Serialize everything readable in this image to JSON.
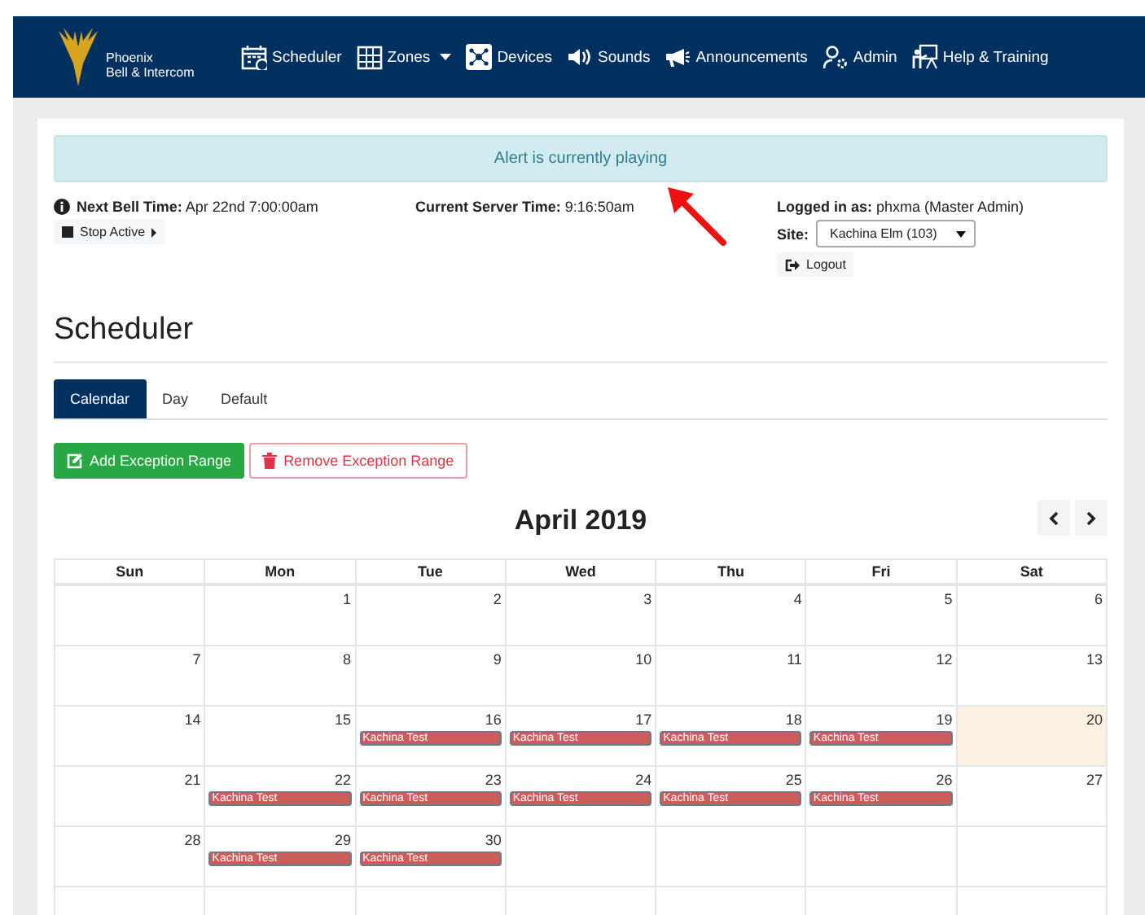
{
  "brand": {
    "line1": "Phoenix",
    "line2": "Bell & Intercom"
  },
  "nav": [
    {
      "label": "Scheduler",
      "dropdown": false
    },
    {
      "label": "Zones",
      "dropdown": true
    },
    {
      "label": "Devices",
      "dropdown": false
    },
    {
      "label": "Sounds",
      "dropdown": false
    },
    {
      "label": "Announcements",
      "dropdown": false
    },
    {
      "label": "Admin",
      "dropdown": false
    },
    {
      "label": "Help & Training",
      "dropdown": false
    }
  ],
  "alert": "Alert is currently playing",
  "info": {
    "next_bell": "**Next Bell Time:** Apr 22nd 7:00:00am",
    "stop_button": "Stop Active",
    "server_time": "**Current Server Time:** 9:16:50am",
    "logged_in": "**Logged in as:** phxma (Master Admin)",
    "site_label": "Site:",
    "site_value": "Kachina Elm (103)",
    "logout_button": "Logout"
  },
  "heading": "Scheduler",
  "tabs": [
    {
      "label": "Calendar",
      "selected": true
    },
    {
      "label": "Day",
      "selected": false
    },
    {
      "label": "Default",
      "selected": false
    }
  ],
  "actions": [
    {
      "label": "Add Exception Range",
      "kind": "add"
    },
    {
      "label": "Remove Exception Range",
      "kind": "remove"
    }
  ],
  "calendar": {
    "title": "April 2019",
    "weekdays": [
      "Sun",
      "Mon",
      "Tue",
      "Wed",
      "Thu",
      "Fri",
      "Sat"
    ],
    "weeks": [
      [
        {
          "empty": true
        },
        {
          "empty": false,
          "day": "1",
          "today": false
        },
        {
          "empty": false,
          "day": "2",
          "today": false
        },
        {
          "empty": false,
          "day": "3",
          "today": false
        },
        {
          "empty": false,
          "day": "4",
          "today": false
        },
        {
          "empty": false,
          "day": "5",
          "today": false
        },
        {
          "empty": false,
          "day": "6",
          "today": false
        }
      ],
      [
        {
          "empty": false,
          "day": "7",
          "today": false
        },
        {
          "empty": false,
          "day": "8",
          "today": false
        },
        {
          "empty": false,
          "day": "9",
          "today": false
        },
        {
          "empty": false,
          "day": "10",
          "today": false
        },
        {
          "empty": false,
          "day": "11",
          "today": false
        },
        {
          "empty": false,
          "day": "12",
          "today": false
        },
        {
          "empty": false,
          "day": "13",
          "today": false
        }
      ],
      [
        {
          "empty": false,
          "day": "14",
          "today": false
        },
        {
          "empty": false,
          "day": "15",
          "today": false
        },
        {
          "empty": false,
          "day": "16",
          "today": false,
          "events": [
            "Kachina Test"
          ]
        },
        {
          "empty": false,
          "day": "17",
          "today": false,
          "events": [
            "Kachina Test"
          ]
        },
        {
          "empty": false,
          "day": "18",
          "today": false,
          "events": [
            "Kachina Test"
          ]
        },
        {
          "empty": false,
          "day": "19",
          "today": false,
          "events": [
            "Kachina Test"
          ]
        },
        {
          "empty": false,
          "day": "20",
          "today": true
        }
      ],
      [
        {
          "empty": false,
          "day": "21",
          "today": false
        },
        {
          "empty": false,
          "day": "22",
          "today": false,
          "events": [
            "Kachina Test"
          ]
        },
        {
          "empty": false,
          "day": "23",
          "today": false,
          "events": [
            "Kachina Test"
          ]
        },
        {
          "empty": false,
          "day": "24",
          "today": false,
          "events": [
            "Kachina Test"
          ]
        },
        {
          "empty": false,
          "day": "25",
          "today": false,
          "events": [
            "Kachina Test"
          ]
        },
        {
          "empty": false,
          "day": "26",
          "today": false,
          "events": [
            "Kachina Test"
          ]
        },
        {
          "empty": false,
          "day": "27",
          "today": false
        }
      ],
      [
        {
          "empty": false,
          "day": "28",
          "today": false
        },
        {
          "empty": false,
          "day": "29",
          "today": false,
          "events": [
            "Kachina Test"
          ]
        },
        {
          "empty": false,
          "day": "30",
          "today": false,
          "events": [
            "Kachina Test"
          ]
        },
        {
          "empty": true
        },
        {
          "empty": true
        },
        {
          "empty": true
        },
        {
          "empty": true
        }
      ],
      [
        {
          "empty": true
        },
        {
          "empty": true
        },
        {
          "empty": true
        },
        {
          "empty": true
        },
        {
          "empty": true
        },
        {
          "empty": true
        },
        {
          "empty": true
        }
      ]
    ]
  }
}
